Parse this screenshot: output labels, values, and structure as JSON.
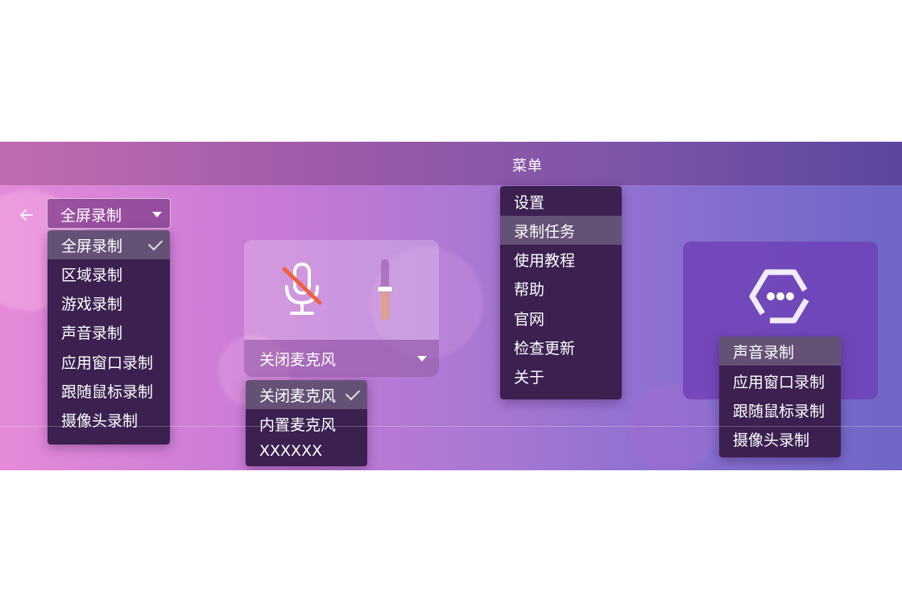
{
  "window": {
    "title": "菜单"
  },
  "record_mode": {
    "selected": "全屏录制",
    "options": [
      "全屏录制",
      "区域录制",
      "游戏录制",
      "声音录制",
      "应用窗口录制",
      "跟随鼠标录制",
      "摄像头录制"
    ],
    "checked_index": 0
  },
  "mic": {
    "selected": "关闭麦克风",
    "options": [
      "关闭麦克风",
      "内置麦克风",
      "XXXXXX"
    ],
    "checked_index": 0,
    "volume_level": 0.5
  },
  "main_menu": {
    "items": [
      "设置",
      "录制任务",
      "使用教程",
      "帮助",
      "官网",
      "检查更新",
      "关于"
    ],
    "highlighted_index": 1
  },
  "more_menu": {
    "items": [
      "声音录制",
      "应用窗口录制",
      "跟随鼠标录制",
      "摄像头录制"
    ],
    "highlighted_index": 0
  },
  "colors": {
    "menu_bg": "#3c2050",
    "accent_slider": "#e0a090",
    "mute_slash": "#f06040"
  },
  "icons": [
    "back-arrow-icon",
    "microphone-muted-icon",
    "more-icon",
    "chevron-down-icon",
    "check-icon"
  ]
}
